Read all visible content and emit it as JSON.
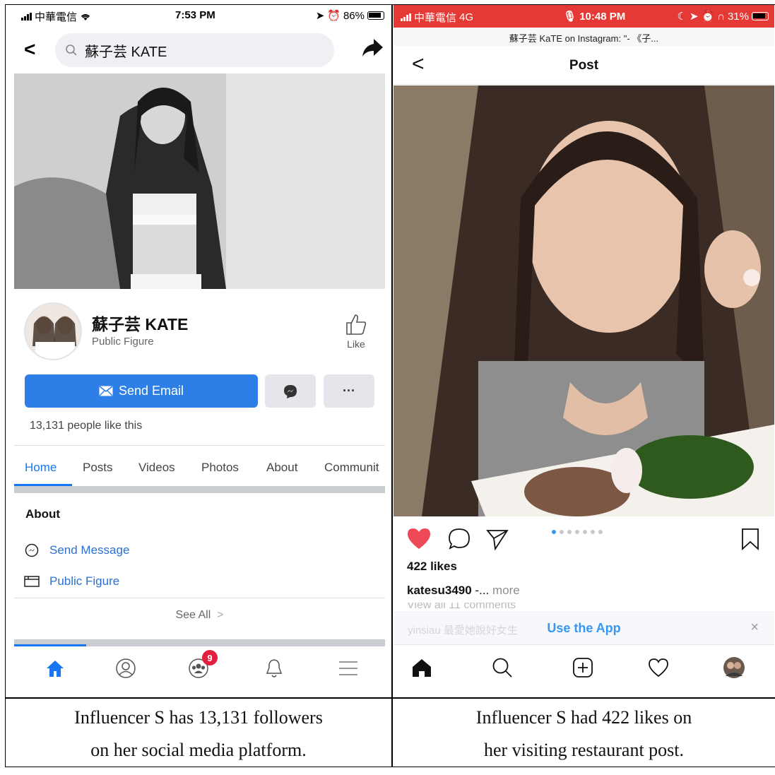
{
  "facebook": {
    "status": {
      "carrier": "中華電信",
      "time": "7:53 PM",
      "battery": "86%"
    },
    "search": {
      "query": "蘇子芸 KATE"
    },
    "page": {
      "name": "蘇子芸 KATE",
      "category": "Public Figure",
      "like_label": "Like"
    },
    "actions": {
      "email_label": "Send Email",
      "more_label": "···"
    },
    "likes_text": "13,131 people like this",
    "tabs": [
      "Home",
      "Posts",
      "Videos",
      "Photos",
      "About",
      "Communit"
    ],
    "about": {
      "heading": "About",
      "items": [
        "Send Message",
        "Public Figure"
      ],
      "see_all": "See All"
    },
    "nav": {
      "groups_badge": "9"
    }
  },
  "instagram": {
    "status": {
      "carrier": "中華電信",
      "network": "4G",
      "time": "10:48 PM",
      "battery": "31%"
    },
    "url_title": "蘇子芸 KaTE on Instagram: \"- 《子...",
    "header_title": "Post",
    "likes": "422 likes",
    "caption": {
      "user": "katesu3490",
      "text": " -... ",
      "more": "more"
    },
    "comments_text": "View all 11 comments",
    "faded_comment": "yinsiau 最愛她說好女生",
    "banner": {
      "use_app": "Use the App",
      "close": "×"
    },
    "carousel": {
      "count": 7,
      "active": 1
    }
  },
  "captions": {
    "left": [
      "Influencer S has 13,131 followers",
      "on her social media platform."
    ],
    "right": [
      "Influencer S had 422 likes on",
      "her visiting restaurant post."
    ]
  },
  "colors": {
    "fb_blue": "#1876f2",
    "fb_button": "#2d7ee6",
    "ig_status_red": "#e53935",
    "ig_heart": "#ed4956",
    "ig_link": "#3897f0"
  }
}
